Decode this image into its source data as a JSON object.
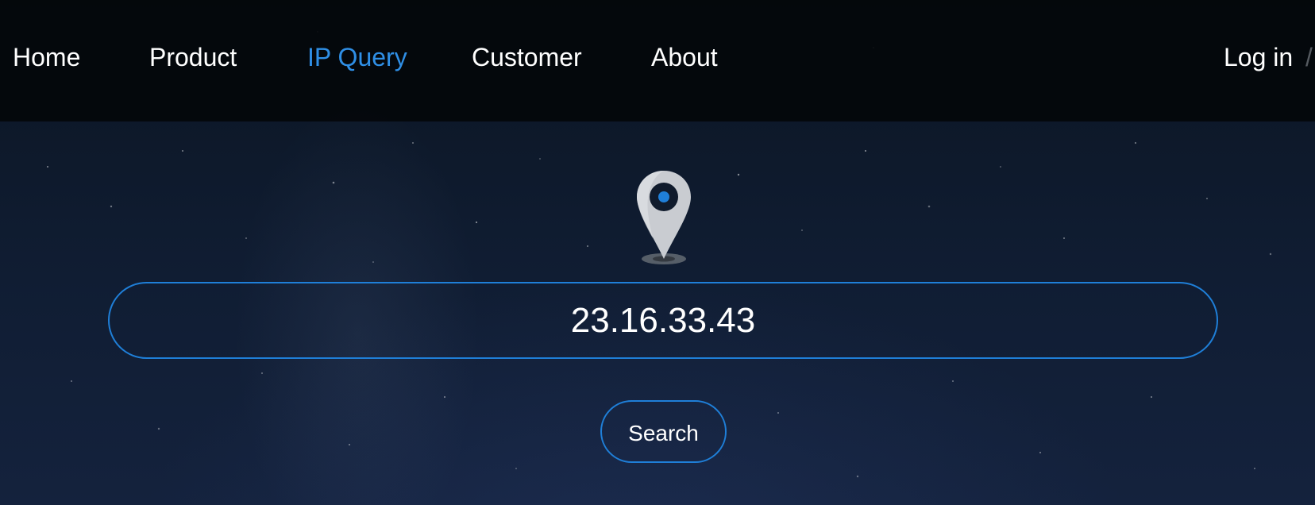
{
  "nav": {
    "items": [
      {
        "label": "Home"
      },
      {
        "label": "Product"
      },
      {
        "label": "IP Query",
        "active": true
      },
      {
        "label": "Customer"
      },
      {
        "label": "About"
      }
    ],
    "login_label": "Log in",
    "separator": "/"
  },
  "search": {
    "value": "23.16.33.43",
    "button_label": "Search"
  },
  "icons": {
    "location": "map-pin-icon"
  },
  "colors": {
    "accent": "#1f7fd8",
    "active_nav": "#2f8fe6",
    "text": "#ffffff"
  }
}
